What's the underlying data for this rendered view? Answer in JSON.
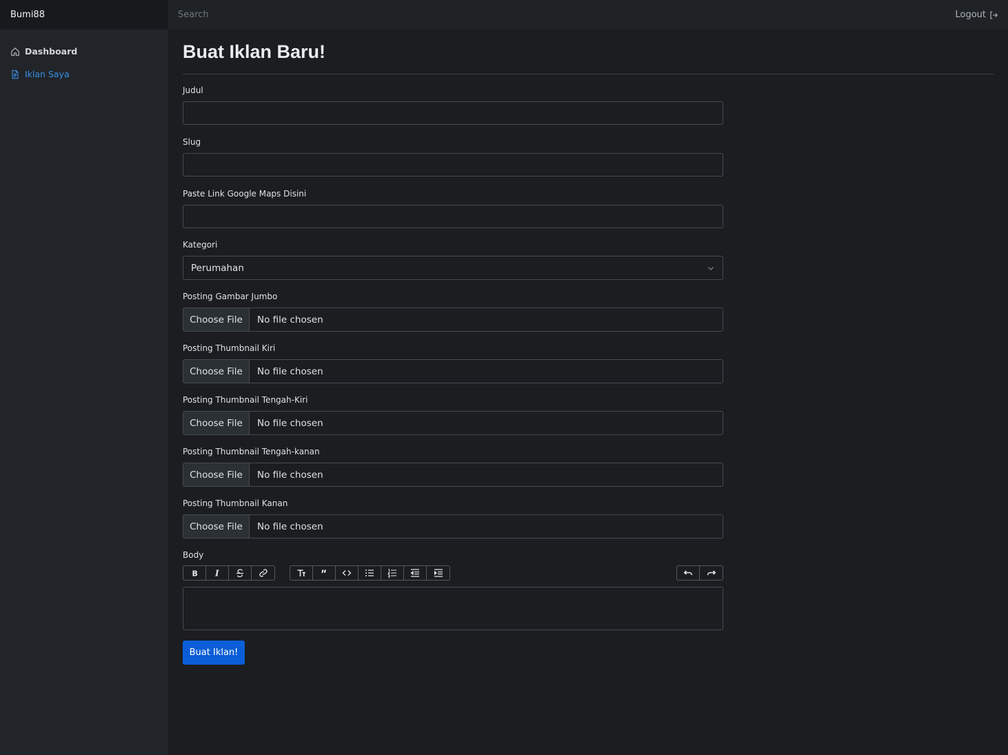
{
  "app": {
    "brand": "Bumi88"
  },
  "header": {
    "search_placeholder": "Search",
    "logout_label": "Logout"
  },
  "sidebar": {
    "items": [
      {
        "label": "Dashboard",
        "icon": "home-icon",
        "active": false
      },
      {
        "label": "Iklan Saya",
        "icon": "file-text-icon",
        "active": true
      }
    ]
  },
  "main": {
    "title": "Buat Iklan Baru!",
    "fields": {
      "judul": {
        "label": "Judul",
        "value": ""
      },
      "slug": {
        "label": "Slug",
        "value": ""
      },
      "maps": {
        "label": "Paste Link Google Maps Disini",
        "value": ""
      },
      "kategori": {
        "label": "Kategori",
        "selected": "Perumahan"
      },
      "files": [
        {
          "label": "Posting Gambar Jumbo",
          "button": "Choose File",
          "status": "No file chosen"
        },
        {
          "label": "Posting Thumbnail Kiri",
          "button": "Choose File",
          "status": "No file chosen"
        },
        {
          "label": "Posting Thumbnail Tengah-Kiri",
          "button": "Choose File",
          "status": "No file chosen"
        },
        {
          "label": "Posting Thumbnail Tengah-kanan",
          "button": "Choose File",
          "status": "No file chosen"
        },
        {
          "label": "Posting Thumbnail Kanan",
          "button": "Choose File",
          "status": "No file chosen"
        }
      ],
      "body": {
        "label": "Body",
        "value": ""
      }
    },
    "toolbar": {
      "groups": [
        [
          "bold-icon",
          "italic-icon",
          "strikethrough-icon",
          "link-icon"
        ],
        [
          "heading-icon",
          "quote-icon",
          "code-icon",
          "bullet-list-icon",
          "numbered-list-icon",
          "outdent-icon",
          "indent-icon"
        ],
        [
          "undo-icon",
          "redo-icon"
        ]
      ]
    },
    "submit_label": "Buat Iklan!"
  },
  "colors": {
    "background": "#1b1d20",
    "sidebar": "#212529",
    "accent": "#3a8ee8",
    "primary_button": "#0b5ed7"
  }
}
